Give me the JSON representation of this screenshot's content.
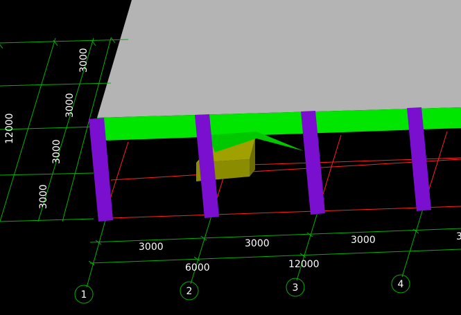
{
  "viewport": {
    "background": "#000000",
    "grid_color": "#00b400",
    "beam_grid_color": "#ff2020",
    "slab_color": "#b4b4b4",
    "beam_color": "#00e600",
    "column_color": "#7a0fd0",
    "footing_color": "#8c8c00",
    "axis_bubble_color": "#00b400"
  },
  "dimensions": {
    "left_segments": [
      "3000",
      "3000",
      "3000",
      "3000"
    ],
    "left_total": "12000",
    "bottom_segments": [
      "3000",
      "3000",
      "3000",
      "3"
    ],
    "bottom_sub_total": "6000",
    "bottom_total": "12000"
  },
  "axes": {
    "labels": [
      "1",
      "2",
      "3",
      "4"
    ]
  }
}
